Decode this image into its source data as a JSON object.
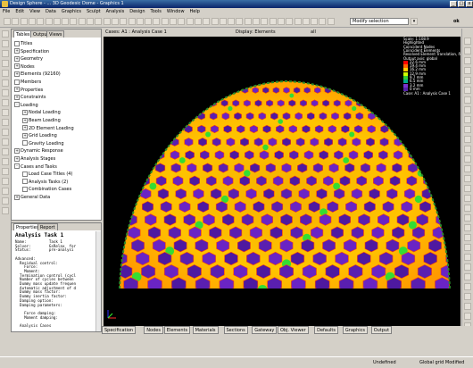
{
  "titlebar": {
    "title": "Design Sphere - ... 3D Geodesic Dome - Graphics 1",
    "minimize": "_",
    "maximize": "□",
    "close": "x"
  },
  "menubar": {
    "items": [
      "File",
      "Edit",
      "View",
      "Data",
      "Graphics",
      "Sculpt",
      "Analysis",
      "Design",
      "Tools",
      "Window",
      "Help"
    ]
  },
  "toolbar": {
    "selection_mode": "Modify selection",
    "ok_label": "ok"
  },
  "tree_tabs": [
    "Tables",
    "Output",
    "Views"
  ],
  "tree": [
    {
      "label": "Titles",
      "level": 0,
      "expander": ""
    },
    {
      "label": "Specification",
      "level": 0,
      "expander": "+"
    },
    {
      "label": "Geometry",
      "level": 0,
      "expander": "+"
    },
    {
      "label": "Nodes",
      "level": 0,
      "expander": "+"
    },
    {
      "label": "Elements (92160)",
      "level": 0,
      "expander": "+"
    },
    {
      "label": "Members",
      "level": 0,
      "expander": ""
    },
    {
      "label": "Properties",
      "level": 0,
      "expander": "+"
    },
    {
      "label": "Constraints",
      "level": 0,
      "expander": "+"
    },
    {
      "label": "Loading",
      "level": 0,
      "expander": "-"
    },
    {
      "label": "Nodal Loading",
      "level": 1,
      "expander": "+"
    },
    {
      "label": "Beam Loading",
      "level": 1,
      "expander": "+"
    },
    {
      "label": "2D Element Loading",
      "level": 1,
      "expander": "+"
    },
    {
      "label": "Grid Loading",
      "level": 1,
      "expander": "+"
    },
    {
      "label": "Gravity Loading",
      "level": 1,
      "expander": ""
    },
    {
      "label": "Dynamic Response",
      "level": 0,
      "expander": "+"
    },
    {
      "label": "Analysis Stages",
      "level": 0,
      "expander": "+"
    },
    {
      "label": "Cases and Tasks",
      "level": 0,
      "expander": "-"
    },
    {
      "label": "Load Case Titles (4)",
      "level": 1,
      "expander": ""
    },
    {
      "label": "Analysis Tasks (2)",
      "level": 1,
      "expander": ""
    },
    {
      "label": "Combination Cases",
      "level": 1,
      "expander": ""
    },
    {
      "label": "General Data",
      "level": 0,
      "expander": "+"
    }
  ],
  "props_tabs": [
    "Properties",
    "Report"
  ],
  "props": {
    "title": "Analysis Task 1",
    "lines": [
      "Name:          Task 1",
      "Solver:        GsRelax  for",
      "Status:        pre-analysi",
      "",
      "Advanced:",
      "  Residual control:",
      "    Force:",
      "    Moment:",
      "  Termination control (cycl",
      "  Number of cycles between",
      "  Dummy mass update frequen",
      "  Automatic adjustment of d",
      "  Dummy mass factor:",
      "  Dummy inertia factor:",
      "  Damping option:",
      "  Damping parameters:",
      "",
      "    Force damping:",
      "    Moment damping:",
      "",
      "  Analysis Cases"
    ]
  },
  "view_header": {
    "cases": "Cases: A1 : Analysis Case 1",
    "display": "Display: Elements",
    "filter": "all"
  },
  "legend": {
    "lines": [
      "Scale: 1:108.9",
      "Highlighted",
      "Coincident Nodes",
      "Coincident Elements",
      "Resolved Element Translation, δ",
      "Output axis: global"
    ],
    "entries": [
      {
        "label": "22.6 mm",
        "color": "#ff0000"
      },
      {
        "label": "19.4 mm",
        "color": "#ff6600"
      },
      {
        "label": "16.2 mm",
        "color": "#ffcc00"
      },
      {
        "label": "12.9 mm",
        "color": "#ccff00"
      },
      {
        "label": "9.7 mm",
        "color": "#33cc33"
      },
      {
        "label": "6.5 mm",
        "color": "#00aa88"
      },
      {
        "label": "3.2 mm",
        "color": "#7733cc"
      },
      {
        "label": "0 mm",
        "color": "#5522aa"
      }
    ],
    "case_label": "Case: A1 : Analysis Case 1"
  },
  "bottom_tabs": [
    "Specification",
    "Nodes",
    "Elements",
    "Materials",
    "Sections",
    "Gateway",
    "Obj. Viewer",
    "Defaults",
    "Graphics",
    "Output"
  ],
  "status": {
    "left": "Undefined",
    "right": "Global grid Modified"
  }
}
